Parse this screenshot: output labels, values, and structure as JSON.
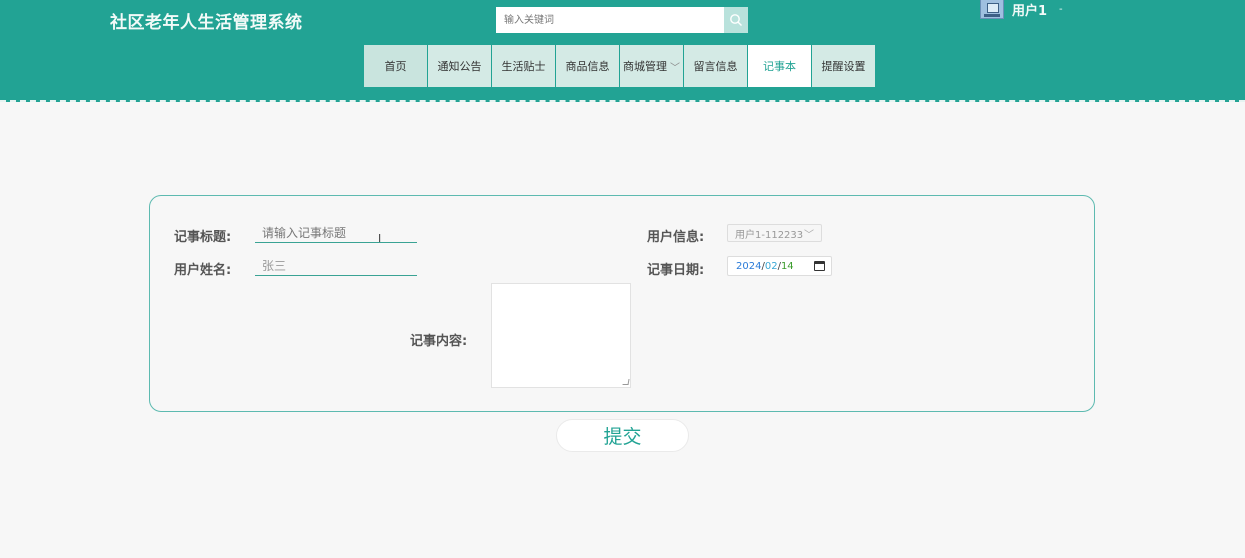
{
  "app": {
    "title": "社区老年人生活管理系统"
  },
  "search": {
    "placeholder": "输入关键词"
  },
  "user": {
    "name": "用户1",
    "caret": "-"
  },
  "nav": {
    "items": [
      {
        "label": "首页"
      },
      {
        "label": "通知公告"
      },
      {
        "label": "生活贴士"
      },
      {
        "label": "商品信息"
      },
      {
        "label": "商城管理"
      },
      {
        "label": "留言信息"
      },
      {
        "label": "记事本"
      },
      {
        "label": "提醒设置"
      }
    ],
    "active": "记事本"
  },
  "form": {
    "title_label": "记事标题:",
    "title_placeholder": "请输入记事标题",
    "user_info_label": "用户信息:",
    "user_info_value": "用户1-112233",
    "username_label": "用户姓名:",
    "username_value": "张三",
    "date_label": "记事日期:",
    "date": {
      "year": "2024",
      "month": "02",
      "day": "14",
      "sep": "/"
    },
    "content_label": "记事内容:",
    "submit_label": "提交"
  },
  "colors": {
    "accent": "#22a394",
    "nav_bg": "#d4eae5",
    "page_bg": "#f7f7f7"
  }
}
